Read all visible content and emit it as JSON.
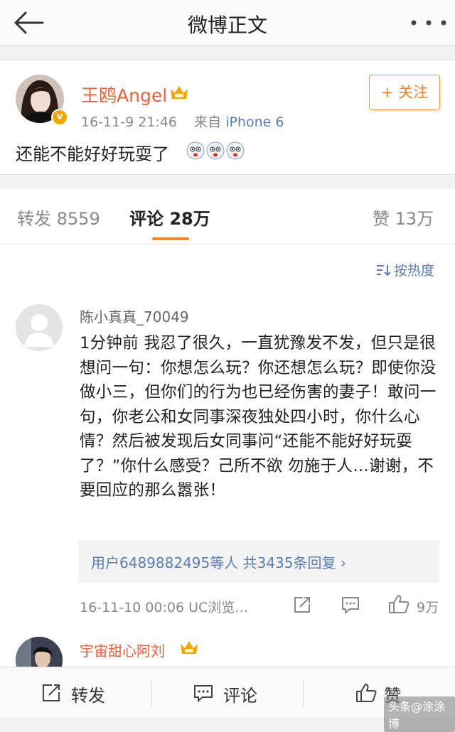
{
  "nav": {
    "title": "微博正文"
  },
  "post": {
    "user_name": "王鸥Angel",
    "badge": "v",
    "timestamp": "16-11-9 21:46",
    "source_prefix": "来自",
    "source": "iPhone 6",
    "follow_label": "关注",
    "text": "还能不能好好玩耍了",
    "emoji_count": 3
  },
  "tabs": {
    "repost_label": "转发",
    "repost_count": "8559",
    "comment_label": "评论",
    "comment_count": "28万",
    "like_label": "赞",
    "like_count": "13万"
  },
  "comments": {
    "sort_label": "按热度",
    "items": [
      {
        "user_name": "陈小真真_70049",
        "text": "1分钟前 我忍了很久，一直犹豫发不发，但只是很想问一句：你想怎么玩？你还想怎么玩？即使你没做小三，但你们的行为也已经伤害的妻子！敢问一句，你老公和女同事深夜独处四小时，你什么心情？然后被发现后女同事问“还能不能好好玩耍了？”你什么感受？己所不欲 勿施于人…谢谢，不要回应的那么嚣张！",
        "reply_summary": "用户6489882495等人 共3435条回复 ›",
        "meta": "16-11-10 00:06 UC浏览…",
        "like_count": "9万"
      },
      {
        "user_name": "宇宙甜心阿刘"
      }
    ]
  },
  "bottom_bar": {
    "repost_label": "转发",
    "comment_label": "评论",
    "like_label": "赞"
  },
  "watermark": "头条@涂涂博"
}
